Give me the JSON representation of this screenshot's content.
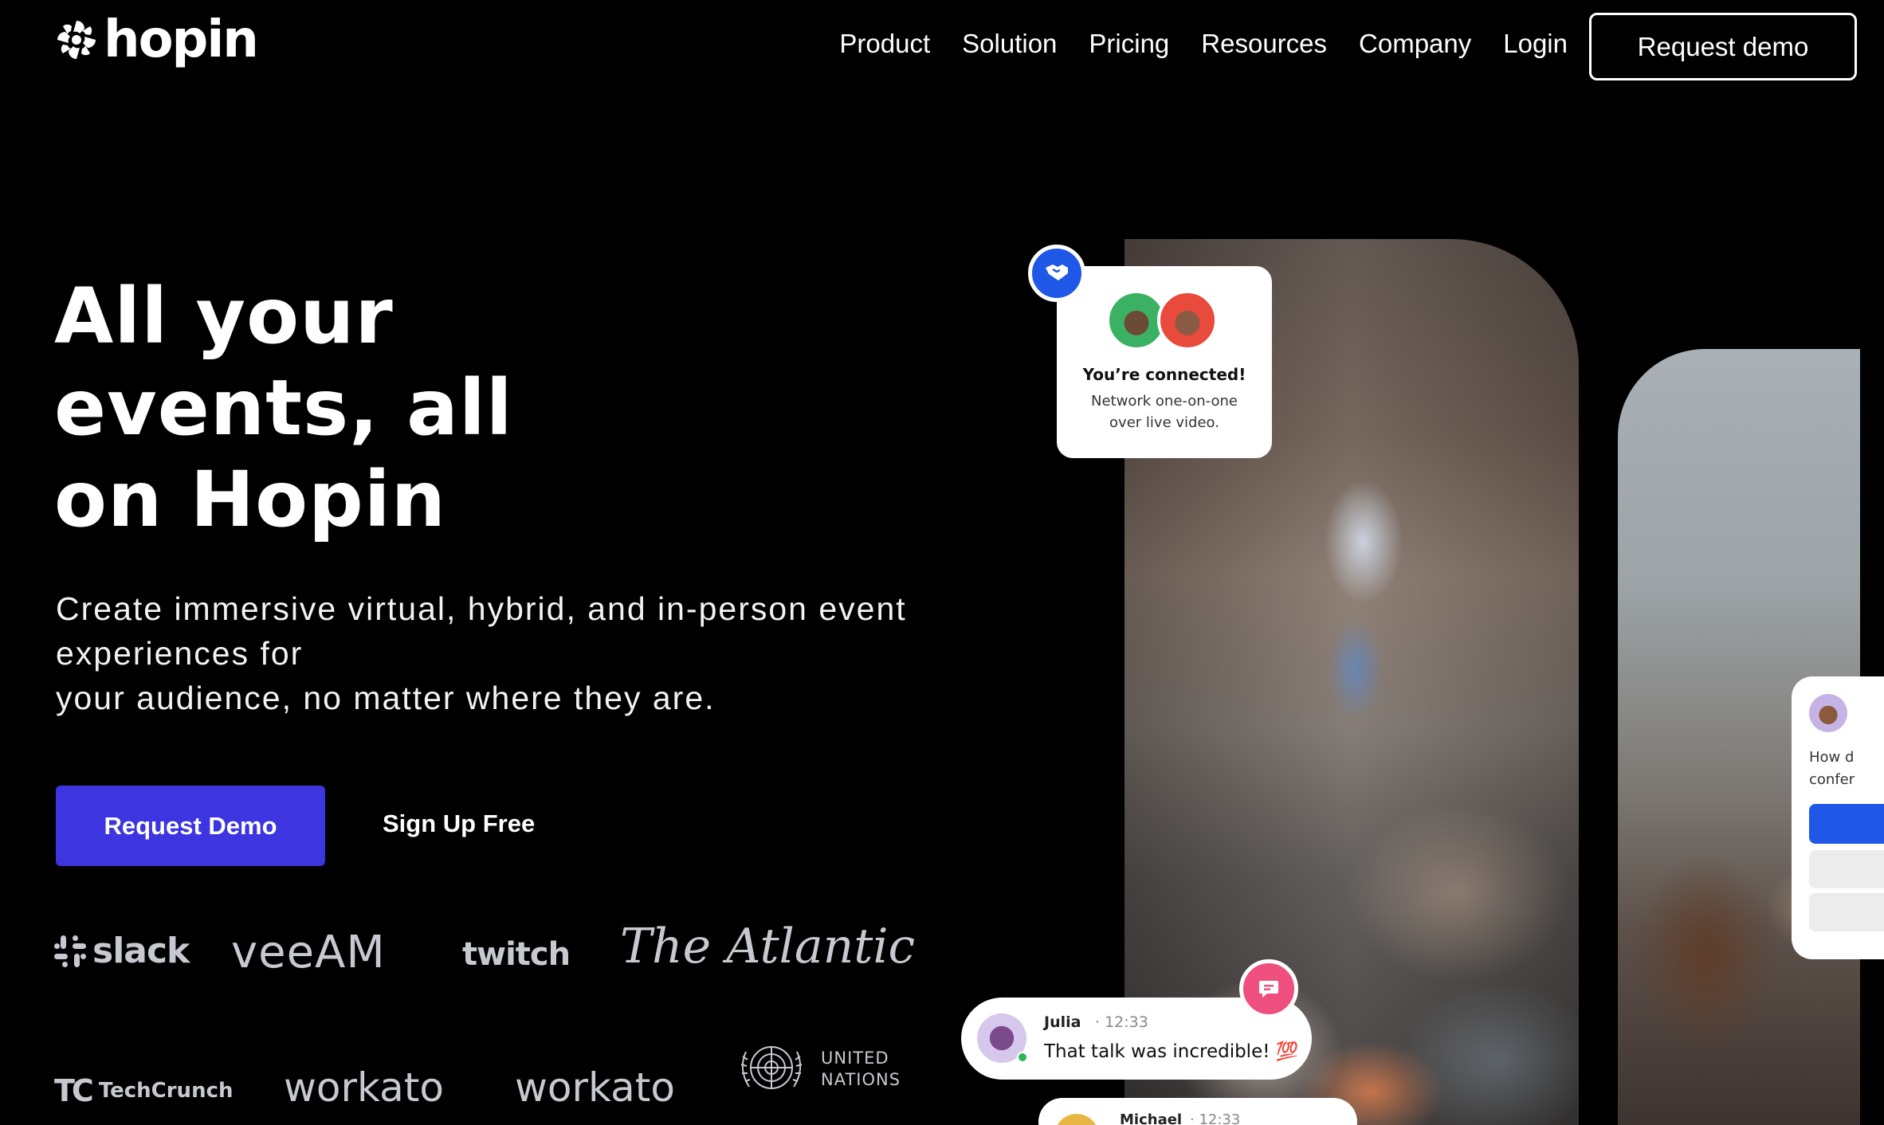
{
  "brand": {
    "name": "hopin"
  },
  "nav": {
    "links": [
      "Product",
      "Solution",
      "Pricing",
      "Resources",
      "Company",
      "Login"
    ],
    "cta": "Request demo"
  },
  "hero": {
    "title_lines": [
      "All your",
      "events, all",
      "on Hopin"
    ],
    "subtitle_lines": [
      "Create immersive virtual, hybrid, and in-person event",
      "experiences for",
      "your audience, no matter where they are."
    ],
    "primary_cta": "Request Demo",
    "secondary_cta": "Sign Up Free"
  },
  "logos": {
    "slack": "slack",
    "veeam": "veeAM",
    "twitch": "twitch",
    "atlantic": "The Atlantic",
    "techcrunch_mark": "TC",
    "techcrunch": "TechCrunch",
    "workato_1": "workato",
    "workato_2": "workato",
    "un_line1": "UNITED",
    "un_line2": "NATIONS"
  },
  "connected_card": {
    "title": "You’re connected!",
    "desc_lines": [
      "Network one-on-one",
      "over live video."
    ]
  },
  "chat_julia": {
    "name": "Julia",
    "time": "· 12:33",
    "message": "That talk was incredible! 💯"
  },
  "chat_michael": {
    "name": "Michael",
    "time": "· 12:33"
  },
  "poll_card": {
    "question_lines": [
      "How d",
      "confer"
    ]
  },
  "colors": {
    "primary": "#3c35e0",
    "accent_blue": "#1f58e6",
    "accent_pink": "#ef4f7f",
    "background": "#000000"
  },
  "icons": [
    "hopin-logo-icon",
    "slack-icon",
    "handshake-icon",
    "chat-icon",
    "un-emblem-icon"
  ]
}
